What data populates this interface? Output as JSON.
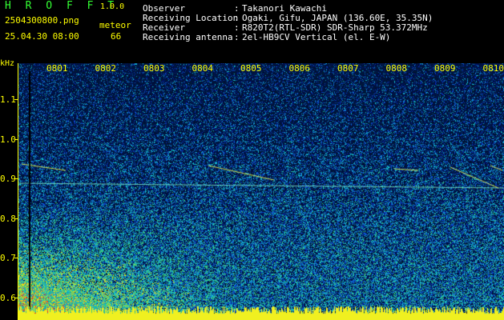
{
  "header": {
    "app_name": "H R O F F T",
    "version": "1.0.0",
    "filename": "2504300800.png",
    "mode": "meteor",
    "datetime": "25.04.30 08:00",
    "count": "66",
    "info": [
      {
        "label": "Observer",
        "value": "Takanori Kawachi"
      },
      {
        "label": "Receiving Location",
        "value": "Ogaki, Gifu, JAPAN (136.60E, 35.35N)"
      },
      {
        "label": "Receiver",
        "value": "R820T2(RTL-SDR) SDR-Sharp 53.372MHz"
      },
      {
        "label": "Receiving antenna",
        "value": "2el-HB9CV Vertical (el. E-W)"
      }
    ],
    "separator": ":"
  },
  "spectrogram": {
    "y_unit": "kHz",
    "y_ticks": [
      "1.1",
      "1.0",
      "0.9",
      "0.8",
      "0.7",
      "0.6"
    ],
    "x_ticks": [
      "0801",
      "0802",
      "0803",
      "0804",
      "0805",
      "0806",
      "0807",
      "0808",
      "0809",
      "0810"
    ],
    "colors": {
      "axis": "#ffff00",
      "background": "#000000",
      "noise_base": "#1040a0"
    }
  }
}
